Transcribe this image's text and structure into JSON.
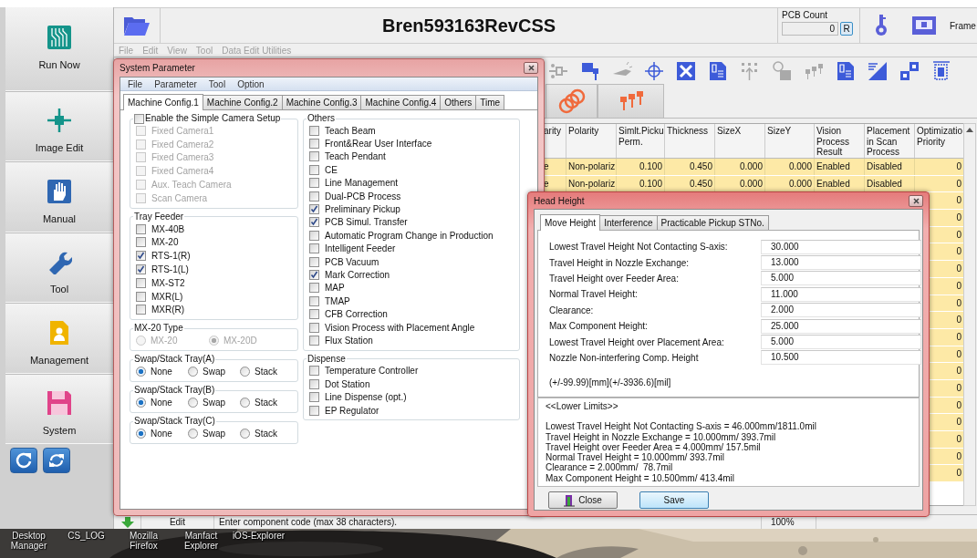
{
  "sidebar": {
    "items": [
      {
        "label": "Run Now"
      },
      {
        "label": "Image Edit"
      },
      {
        "label": "Manual"
      },
      {
        "label": "Tool"
      },
      {
        "label": "Management"
      },
      {
        "label": "System"
      }
    ]
  },
  "app": {
    "title": "Bren593163RevCSS",
    "menu": [
      {
        "label": "File",
        "disabled": true
      },
      {
        "label": "Edit",
        "disabled": true
      },
      {
        "label": "View",
        "disabled": true
      },
      {
        "label": "Tool",
        "disabled": true
      },
      {
        "label": "Data Edit Utilities",
        "disabled": true
      }
    ],
    "pcb_count": {
      "label": "PCB Count",
      "value": "0",
      "reset_label": "R"
    },
    "frame_label": "Frame",
    "toolbar": [
      {
        "disabled": true
      },
      {
        "disabled": false
      },
      {
        "disabled": true
      },
      {
        "disabled": false
      },
      {
        "disabled": false
      },
      {
        "disabled": false
      },
      {
        "disabled": true
      },
      {
        "disabled": true
      },
      {
        "disabled": true
      },
      {
        "disabled": false
      },
      {
        "disabled": false
      },
      {
        "disabled": false
      },
      {
        "disabled": false
      }
    ]
  },
  "table": {
    "columns": [
      "arity",
      "Polarity",
      "Simlt.Picku Perm.",
      "Thickness",
      "SizeX",
      "SizeY",
      "Vision Process Result",
      "Placement in Scan Process",
      "Optimizatio Priority"
    ],
    "rows": [
      {
        "cells": [
          "e",
          "Non-polariz",
          "0.100",
          "0.450",
          "0.000",
          "0.000",
          "Enabled",
          "Disabled",
          "0"
        ]
      },
      {
        "cells": [
          "e",
          "Non-polariz",
          "0.100",
          "0.450",
          "0.000",
          "0.000",
          "Enabled",
          "Disabled",
          "0"
        ]
      },
      {
        "cells": [
          "0"
        ]
      },
      {
        "cells": [
          "0"
        ]
      },
      {
        "cells": [
          "0"
        ]
      },
      {
        "cells": [
          "0"
        ]
      },
      {
        "cells": [
          "0"
        ]
      },
      {
        "cells": [
          "0"
        ]
      },
      {
        "cells": [
          "0"
        ]
      },
      {
        "cells": [
          "0"
        ]
      },
      {
        "cells": [
          "0"
        ]
      },
      {
        "cells": [
          "0"
        ]
      },
      {
        "cells": [
          "0"
        ]
      },
      {
        "cells": [
          "0"
        ]
      },
      {
        "cells": [
          "0"
        ]
      },
      {
        "cells": [
          "0"
        ]
      },
      {
        "cells": [
          "0"
        ]
      },
      {
        "cells": [
          "0"
        ]
      },
      {
        "cells": [
          "0"
        ]
      }
    ]
  },
  "status_bar": {
    "mode": "Edit",
    "message": "Enter component code (max 38 characters).",
    "zoom": "100%"
  },
  "system_parameter": {
    "title": "System Parameter",
    "menu": [
      "File",
      "Parameter",
      "Tool",
      "Option"
    ],
    "tabs": [
      {
        "label": "Machine Config.1",
        "selected": true
      },
      {
        "label": "Machine Config.2",
        "selected": false
      },
      {
        "label": "Machine Config.3",
        "selected": false
      },
      {
        "label": "Machine Config.4",
        "selected": false
      },
      {
        "label": "Others",
        "selected": false
      },
      {
        "label": "Time",
        "selected": false
      }
    ],
    "left_column": [
      {
        "kind": "checkbox-group",
        "title": "Enable the Simple Camera Setup",
        "checked": false,
        "items": [
          {
            "label": "Fixed Camera1",
            "checked": false,
            "disabled": true
          },
          {
            "label": "Fixed Camera2",
            "checked": false,
            "disabled": true
          },
          {
            "label": "Fixed Camera3",
            "checked": false,
            "disabled": true
          },
          {
            "label": "Fixed Camera4",
            "checked": false,
            "disabled": true
          },
          {
            "label": "Aux. Teach Camera",
            "checked": false,
            "disabled": true
          },
          {
            "label": "Scan Camera",
            "checked": false,
            "disabled": true
          }
        ]
      },
      {
        "kind": "checkboxes",
        "title": "Tray Feeder",
        "items": [
          {
            "label": "MX-40B",
            "checked": false,
            "disabled": false
          },
          {
            "label": "MX-20",
            "checked": false,
            "disabled": false
          },
          {
            "label": "RTS-1(R)",
            "checked": true,
            "disabled": false
          },
          {
            "label": "RTS-1(L)",
            "checked": true,
            "disabled": false
          },
          {
            "label": "MX-ST2",
            "checked": false,
            "disabled": false
          },
          {
            "label": "MXR(L)",
            "checked": false,
            "disabled": false
          },
          {
            "label": "MXR(R)",
            "checked": false,
            "disabled": false
          }
        ]
      },
      {
        "kind": "radios",
        "title": "MX-20 Type",
        "options": [
          {
            "label": "MX-20",
            "selected": false,
            "disabled": true
          },
          {
            "label": "MX-20D",
            "selected": true,
            "disabled": true
          }
        ]
      },
      {
        "kind": "radios",
        "title": "Swap/Stack Tray(A)",
        "options": [
          {
            "label": "None",
            "selected": true,
            "disabled": false
          },
          {
            "label": "Swap",
            "selected": false,
            "disabled": false
          },
          {
            "label": "Stack",
            "selected": false,
            "disabled": false
          }
        ]
      },
      {
        "kind": "radios",
        "title": "Swap/Stack Tray(B)",
        "options": [
          {
            "label": "None",
            "selected": true,
            "disabled": false
          },
          {
            "label": "Swap",
            "selected": false,
            "disabled": false
          },
          {
            "label": "Stack",
            "selected": false,
            "disabled": false
          }
        ]
      },
      {
        "kind": "radios",
        "title": "Swap/Stack Tray(C)",
        "options": [
          {
            "label": "None",
            "selected": true,
            "disabled": false
          },
          {
            "label": "Swap",
            "selected": false,
            "disabled": false
          },
          {
            "label": "Stack",
            "selected": false,
            "disabled": false
          }
        ]
      }
    ],
    "right_column": [
      {
        "kind": "checkboxes",
        "title": "Others",
        "items": [
          {
            "label": "Teach Beam",
            "checked": false,
            "disabled": false
          },
          {
            "label": "Front&Rear User Interface",
            "checked": false,
            "disabled": false
          },
          {
            "label": "Teach Pendant",
            "checked": false,
            "disabled": false
          },
          {
            "label": "CE",
            "checked": false,
            "disabled": false
          },
          {
            "label": "Line Management",
            "checked": false,
            "disabled": false
          },
          {
            "label": "Dual-PCB Process",
            "checked": false,
            "disabled": false
          },
          {
            "label": "Preliminary Pickup",
            "checked": true,
            "disabled": false
          },
          {
            "label": "PCB Simul. Transfer",
            "checked": true,
            "disabled": false
          },
          {
            "label": "Automatic Program Change in Production",
            "checked": false,
            "disabled": false
          },
          {
            "label": "Intelligent Feeder",
            "checked": false,
            "disabled": false
          },
          {
            "label": "PCB Vacuum",
            "checked": false,
            "disabled": false
          },
          {
            "label": "Mark Correction",
            "checked": true,
            "disabled": false
          },
          {
            "label": "MAP",
            "checked": false,
            "disabled": false
          },
          {
            "label": "TMAP",
            "checked": false,
            "disabled": false
          },
          {
            "label": "CFB Correction",
            "checked": false,
            "disabled": false
          },
          {
            "label": "Vision Process with Placement Angle",
            "checked": false,
            "disabled": false
          },
          {
            "label": "Flux Station",
            "checked": false,
            "disabled": false
          }
        ]
      },
      {
        "kind": "checkboxes",
        "title": "Dispense",
        "items": [
          {
            "label": "Temperature Controller",
            "checked": false,
            "disabled": false
          },
          {
            "label": "Dot Station",
            "checked": false,
            "disabled": false
          },
          {
            "label": "Line Dispense (opt.)",
            "checked": false,
            "disabled": false
          },
          {
            "label": "EP Regulator",
            "checked": false,
            "disabled": false
          }
        ]
      }
    ]
  },
  "head_height": {
    "title": "Head Height",
    "tabs": [
      {
        "label": "Move Height",
        "selected": true
      },
      {
        "label": "Interference",
        "selected": false
      },
      {
        "label": "Practicable Pickup STNo.",
        "selected": false
      }
    ],
    "fields": [
      {
        "label": "Lowest Travel Height Not Contacting S-axis:",
        "value": "30.000"
      },
      {
        "label": "Travel Height in Nozzle Exchange:",
        "value": "13.000"
      },
      {
        "label": "Travel Height over Feeder Area:",
        "value": "5.000"
      },
      {
        "label": "Normal Travel Height:",
        "value": "11.000"
      },
      {
        "label": "Clearance:",
        "value": "2.000"
      },
      {
        "label": "Max Component Height:",
        "value": "25.000"
      },
      {
        "label": "Lowest Travel Height over Placement Area:",
        "value": "5.000"
      },
      {
        "label": "Nozzle Non-interfering Comp. Height",
        "value": "10.500"
      }
    ],
    "range_note": "(+/-99.99)[mm](+/-3936.6)[mil]",
    "lower_limits": {
      "heading": "<<Lower Limits>>",
      "lines": [
        "Lowest Travel Height Not Contacting S-axis = 46.000mm/1811.0mil",
        "Travel Height in Nozzle Exchange = 10.000mm/ 393.7mil",
        "Travel Height over Feeder Area = 4.000mm/ 157.5mil",
        "Normal Travel Height = 10.000mm/ 393.7mil",
        "Clearance = 2.000mm/  78.7mil",
        "Max Component Height = 10.500mm/ 413.4mil"
      ]
    },
    "buttons": [
      {
        "label": "Close",
        "focused": false
      },
      {
        "label": "Save",
        "focused": true
      }
    ]
  },
  "desktop_icons": [
    {
      "label": "Desktop Manager"
    },
    {
      "label": "CS_LOG"
    },
    {
      "label": "Mozilla Firefox"
    },
    {
      "label": "Manfact Explorer"
    },
    {
      "label": "iOS-Explorer"
    }
  ]
}
